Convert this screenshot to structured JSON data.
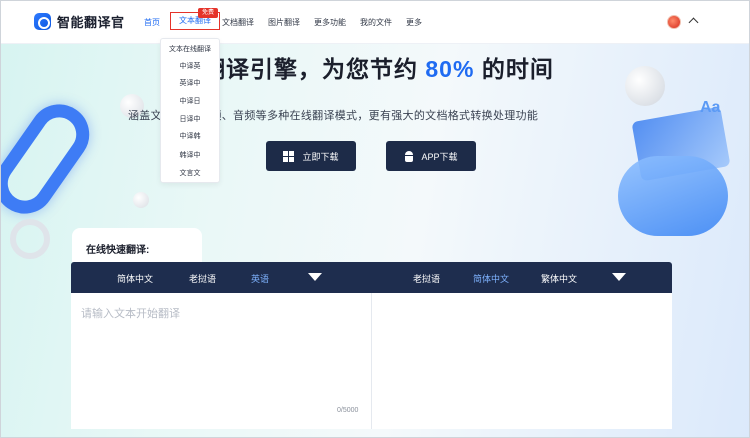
{
  "app": {
    "name": "智能翻译官"
  },
  "nav": {
    "items": [
      {
        "label": "首页",
        "active": true
      },
      {
        "label": "文本翻译",
        "badge": "免费"
      },
      {
        "label": "文档翻译"
      },
      {
        "label": "图片翻译"
      },
      {
        "label": "更多功能"
      },
      {
        "label": "我的文件"
      },
      {
        "label": "更多"
      }
    ]
  },
  "dropdown": {
    "items": [
      "文本在线翻译",
      "中译英",
      "英译中",
      "中译日",
      "日译中",
      "中译韩",
      "韩译中",
      "文言文"
    ]
  },
  "hero": {
    "title_pre": "能翻译引擎，为您节约 ",
    "title_highlight": "80%",
    "title_post": " 的时间",
    "subtitle": "涵盖文        图片、视频、音频等多种在线翻译模式，更有强大的文档格式转换处理功能",
    "btn_windows": "立即下载",
    "btn_app": "APP下载"
  },
  "translator": {
    "tab_label": "在线快速翻译:",
    "source_langs": [
      "简体中文",
      "老挝语",
      "英语"
    ],
    "target_langs": [
      "老挝语",
      "简体中文",
      "繁体中文"
    ],
    "source_selected": "英语",
    "target_selected": "简体中文",
    "placeholder": "请输入文本开始翻译",
    "counter": "0/5000"
  },
  "colors": {
    "accent": "#1f6bf2",
    "lang_bar": "#1e2d4e",
    "badge": "#e5332a"
  }
}
